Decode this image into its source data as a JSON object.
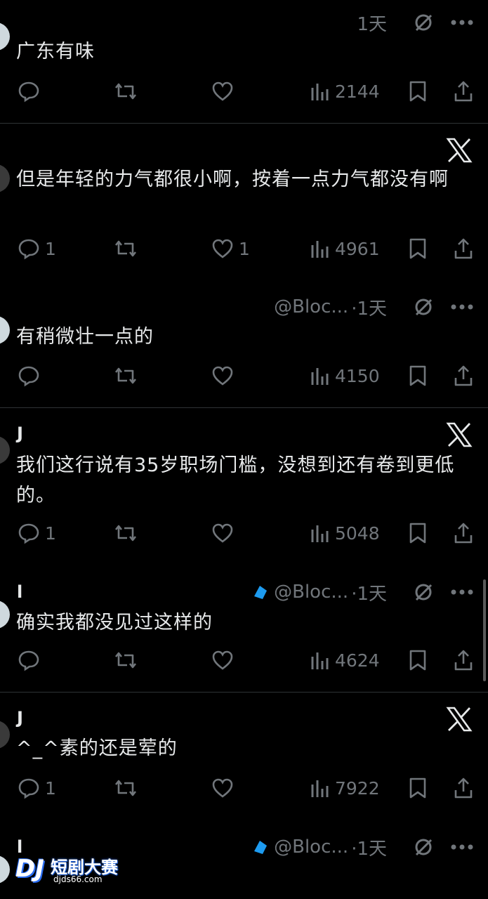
{
  "tweets": [
    {
      "name": "",
      "handle": "",
      "time": "1天",
      "text": "广东有味",
      "replies": "",
      "likes": "",
      "views": "2144",
      "show_meta": true,
      "x_logo": false
    },
    {
      "name": "",
      "handle": "",
      "time": "",
      "text": "但是年轻的力气都很小啊，按着一点力气都没有啊",
      "replies": "1",
      "likes": "1",
      "views": "4961",
      "show_meta": false,
      "x_logo": true
    },
    {
      "name": "",
      "handle": "@Bloc...",
      "time": "·1天",
      "text": "有稍微壮一点的",
      "replies": "",
      "likes": "",
      "views": "4150",
      "show_meta": true,
      "x_logo": false
    },
    {
      "name": "J",
      "handle": "",
      "time": "",
      "text": "我们这行说有35岁职场门槛，没想到还有卷到更低的。",
      "replies": "1",
      "likes": "",
      "views": "5048",
      "show_meta": false,
      "x_logo": true
    },
    {
      "name": "l",
      "handle": "@Bloc...",
      "time": "·1天",
      "text": "确实我都没见过这样的",
      "replies": "",
      "likes": "",
      "views": "4624",
      "show_meta": true,
      "x_logo": false
    },
    {
      "name": "J",
      "handle": "",
      "time": "",
      "text": "^_^素的还是荤的",
      "replies": "1",
      "likes": "",
      "views": "7922",
      "show_meta": false,
      "x_logo": true
    },
    {
      "name": "l",
      "handle": "@Bloc...",
      "time": "·1天",
      "text": "",
      "replies": "",
      "likes": "",
      "views": "",
      "show_meta": true,
      "x_logo": false
    }
  ],
  "watermark": {
    "brand": "短剧大赛",
    "site": "djds66.com",
    "logo": "DJ"
  },
  "colors": {
    "background": "#000000",
    "text": "#e7e9ea",
    "muted": "#71767b",
    "verified": "#1d9bf0"
  }
}
